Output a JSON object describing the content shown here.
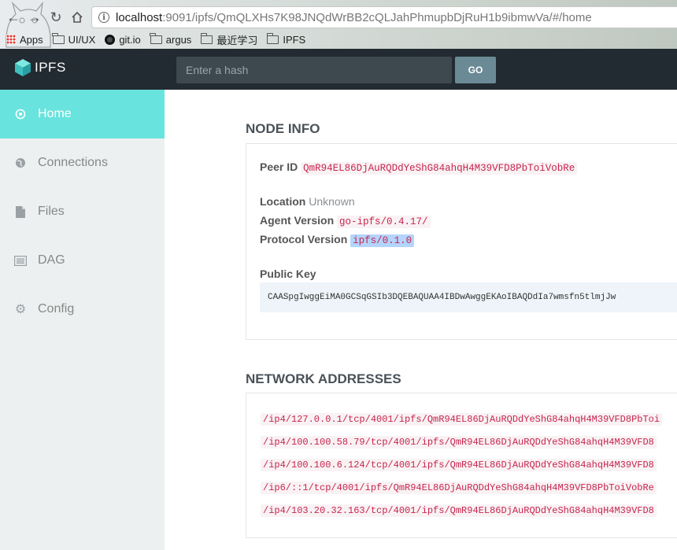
{
  "browser": {
    "url_host": "localhost",
    "url_rest": ":9091/ipfs/QmQLXHs7K98JNQdWrBB2cQLJahPhmupbDjRuH1b9ibmwVa/#/home",
    "bookmarks": [
      {
        "label": "Apps",
        "icon": "apps-icon"
      },
      {
        "label": "UI/UX",
        "icon": "folder-icon"
      },
      {
        "label": "git.io",
        "icon": "github-icon"
      },
      {
        "label": "argus",
        "icon": "folder-icon"
      },
      {
        "label": "最近学习",
        "icon": "folder-icon"
      },
      {
        "label": "IPFS",
        "icon": "folder-icon"
      }
    ]
  },
  "header": {
    "logo_text": "IPFS",
    "search_placeholder": "Enter a hash",
    "go_label": "GO"
  },
  "sidebar": {
    "items": [
      {
        "label": "Home",
        "icon": "target-icon",
        "active": true
      },
      {
        "label": "Connections",
        "icon": "globe-icon",
        "active": false
      },
      {
        "label": "Files",
        "icon": "file-icon",
        "active": false
      },
      {
        "label": "DAG",
        "icon": "list-icon",
        "active": false
      },
      {
        "label": "Config",
        "icon": "gear-icon",
        "active": false
      }
    ]
  },
  "node_info": {
    "title": "NODE INFO",
    "peer_id_label": "Peer ID",
    "peer_id": "QmR94EL86DjAuRQDdYeShG84ahqH4M39VFD8PbToiVobRe",
    "location_label": "Location",
    "location": "Unknown",
    "agent_label": "Agent Version",
    "agent": "go-ipfs/0.4.17/",
    "protocol_label": "Protocol Version",
    "protocol": "ipfs/0.1.0",
    "pubkey_label": "Public Key",
    "pubkey": "CAASpgIwggEiMA0GCSqGSIb3DQEBAQUAA4IBDwAwggEKAoIBAQDdIa7wmsfn5tlmjJw"
  },
  "network": {
    "title": "NETWORK ADDRESSES",
    "addresses": [
      "/ip4/127.0.0.1/tcp/4001/ipfs/QmR94EL86DjAuRQDdYeShG84ahqH4M39VFD8PbToi",
      "/ip4/100.100.58.79/tcp/4001/ipfs/QmR94EL86DjAuRQDdYeShG84ahqH4M39VFD8",
      "/ip4/100.100.6.124/tcp/4001/ipfs/QmR94EL86DjAuRQDdYeShG84ahqH4M39VFD8",
      "/ip6/::1/tcp/4001/ipfs/QmR94EL86DjAuRQDdYeShG84ahqH4M39VFD8PbToiVobRe",
      "/ip4/103.20.32.163/tcp/4001/ipfs/QmR94EL86DjAuRQDdYeShG84ahqH4M39VFD8"
    ]
  },
  "colors": {
    "sidebar_active": "#69e3dd",
    "header_bg": "#222b31",
    "code_red": "#c7254e"
  }
}
